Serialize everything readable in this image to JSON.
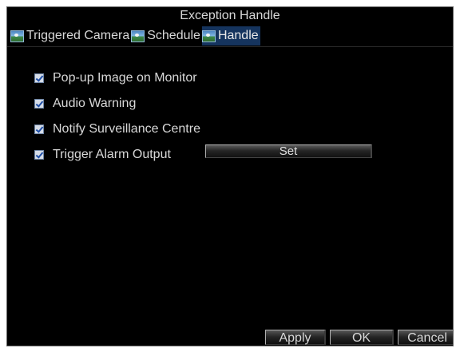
{
  "window": {
    "title": "Exception Handle"
  },
  "tabs": [
    {
      "label": "Triggered Camera",
      "icon": "camera-icon",
      "active": false
    },
    {
      "label": "Schedule",
      "icon": "camera-icon",
      "active": false
    },
    {
      "label": "Handle",
      "icon": "camera-icon",
      "active": true
    }
  ],
  "options": [
    {
      "label": "Pop-up Image on Monitor",
      "checked": true
    },
    {
      "label": "Audio Warning",
      "checked": true
    },
    {
      "label": "Notify Surveillance Centre",
      "checked": true
    },
    {
      "label": "Trigger Alarm Output",
      "checked": true
    }
  ],
  "set_button": {
    "label": "Set"
  },
  "footer": {
    "apply_label": "Apply",
    "ok_label": "OK",
    "cancel_label": "Cancel"
  },
  "colors": {
    "background": "#000000",
    "text": "#d8d8d8",
    "active_tab": "#15345e",
    "checkbox_check": "#1f4fa8"
  }
}
